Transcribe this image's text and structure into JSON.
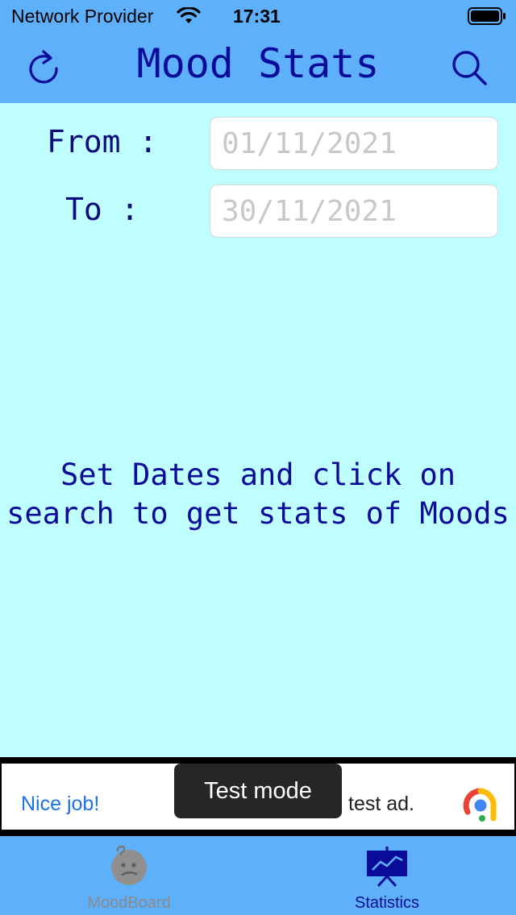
{
  "status_bar": {
    "carrier": "Network Provider",
    "time": "17:31"
  },
  "header": {
    "title": "Mood Stats",
    "left_icon": "refresh-icon",
    "right_icon": "search-icon"
  },
  "filters": {
    "from_label": "From :",
    "from_value": "01/11/2021",
    "to_label": "To :",
    "to_value": "30/11/2021"
  },
  "message": {
    "line1": "Set Dates and click on",
    "line2": "search to get stats of Moods"
  },
  "ad": {
    "text_left": "Nice job!",
    "text_right": "test ad.",
    "toast": "Test mode"
  },
  "tabs": [
    {
      "label": "MoodBoard",
      "icon": "confused-face-icon",
      "selected": false
    },
    {
      "label": "Statistics",
      "icon": "chart-board-icon",
      "selected": true
    }
  ],
  "colors": {
    "header": "#5fb0fb",
    "background": "#bfffff",
    "text": "#0b0b9a"
  }
}
